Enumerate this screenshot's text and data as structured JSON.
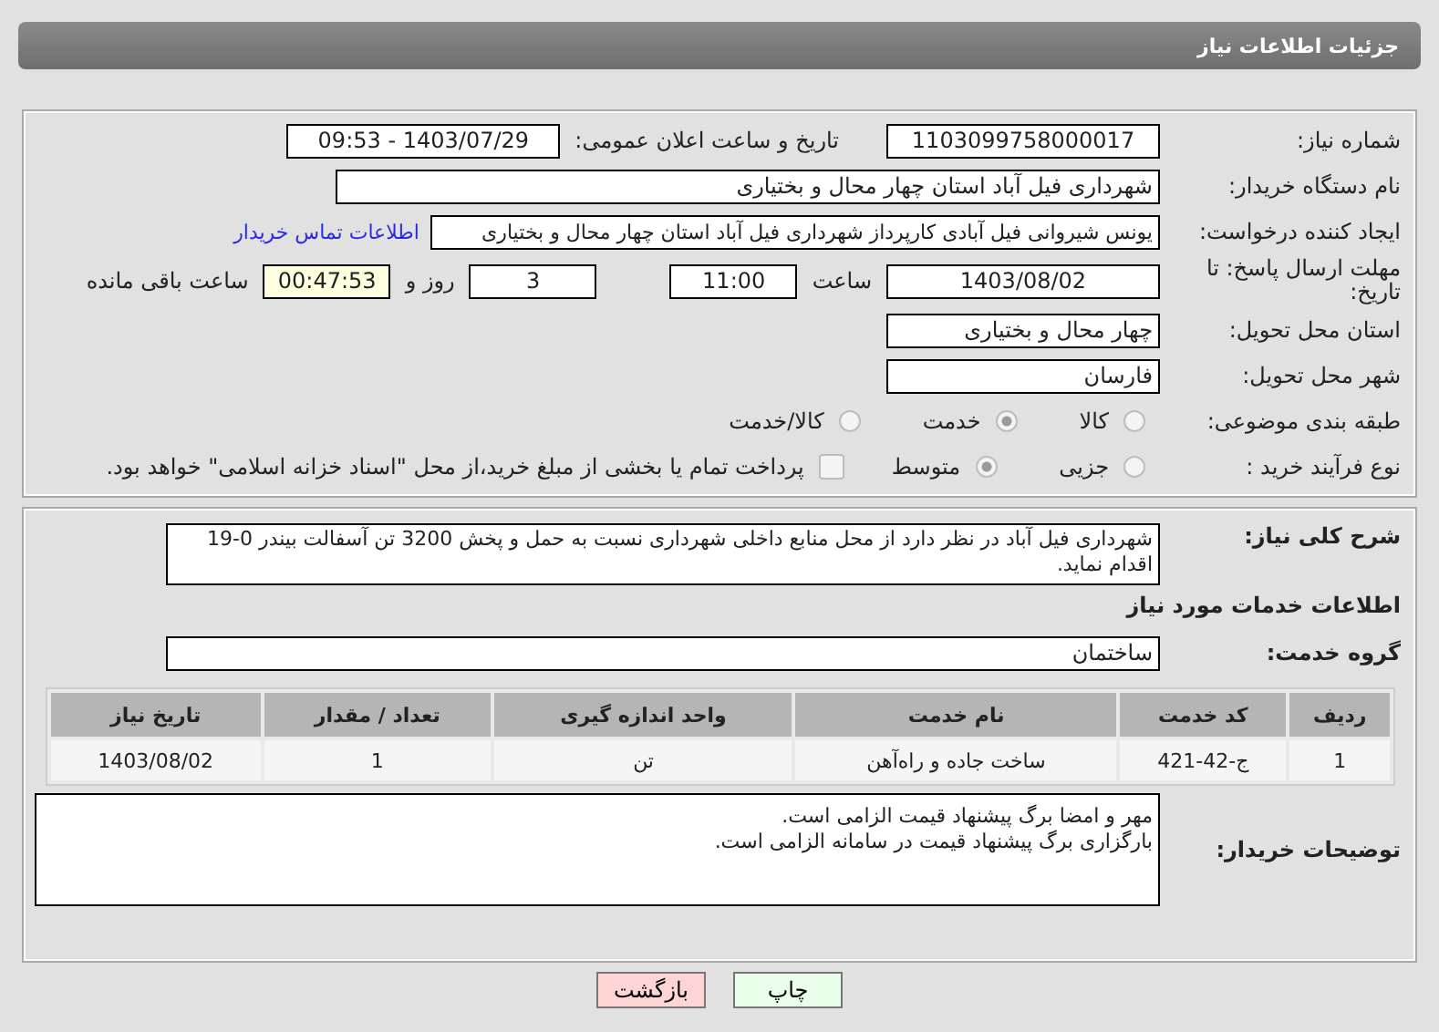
{
  "header": {
    "title": "جزئیات اطلاعات نیاز"
  },
  "need_number": {
    "label": "شماره نیاز:",
    "value": "1103099758000017"
  },
  "announce": {
    "label": "تاریخ و ساعت اعلان عمومی:",
    "value": "1403/07/29 - 09:53"
  },
  "buyer_org": {
    "label": "نام دستگاه خریدار:",
    "value": "شهرداری فیل آباد استان چهار محال و بختیاری"
  },
  "creator": {
    "label": "ایجاد کننده درخواست:",
    "value": "یونس شیروانی فیل آبادی کارپرداز شهرداری فیل آباد استان چهار محال و بختیاری",
    "link": "اطلاعات تماس خریدار"
  },
  "deadline": {
    "label": "مهلت ارسال پاسخ: تا تاریخ:",
    "date": "1403/08/02",
    "time_label": "ساعت",
    "time": "11:00",
    "days": "3",
    "days_label": "روز و",
    "remaining": "00:47:53",
    "remaining_label": "ساعت باقی مانده"
  },
  "province": {
    "label": "استان محل تحویل:",
    "value": "چهار محال و بختیاری"
  },
  "city": {
    "label": "شهر محل تحویل:",
    "value": "فارسان"
  },
  "category": {
    "label": "طبقه بندی موضوعی:",
    "options": [
      {
        "label": "کالا",
        "selected": false
      },
      {
        "label": "خدمت",
        "selected": true
      },
      {
        "label": "کالا/خدمت",
        "selected": false
      }
    ]
  },
  "process": {
    "label": "نوع فرآیند خرید :",
    "options": [
      {
        "label": "جزیی",
        "selected": false
      },
      {
        "label": "متوسط",
        "selected": true
      }
    ],
    "treasury": {
      "checked": false,
      "label": "پرداخت تمام یا بخشی از مبلغ خرید،از محل \"اسناد خزانه اسلامی\" خواهد بود."
    }
  },
  "description": {
    "label": "شرح کلی نیاز:",
    "value": "شهرداری فیل آباد در نظر دارد از محل منابع داخلی شهرداری نسبت به حمل و پخش 3200 تن آسفالت بیندر 0-19 اقدام نماید."
  },
  "services_title": "اطلاعات خدمات مورد نیاز",
  "service_group": {
    "label": "گروه خدمت:",
    "value": "ساختمان"
  },
  "table": {
    "columns": [
      "ردیف",
      "کد خدمت",
      "نام خدمت",
      "واحد اندازه گیری",
      "تعداد / مقدار",
      "تاریخ نیاز"
    ],
    "rows": [
      [
        "1",
        "ج-42-421",
        "ساخت جاده و راه‌آهن",
        "تن",
        "1",
        "1403/08/02"
      ]
    ]
  },
  "buyer_notes": {
    "label": "توضیحات خریدار:",
    "lines": [
      "مهر و امضا برگ پیشنهاد قیمت الزامی است.",
      "بارگزاری برگ پیشنهاد قیمت در سامانه الزامی است."
    ]
  },
  "buttons": [
    {
      "label": "چاپ",
      "kind": "print"
    },
    {
      "label": "بازگشت",
      "kind": "back"
    }
  ]
}
